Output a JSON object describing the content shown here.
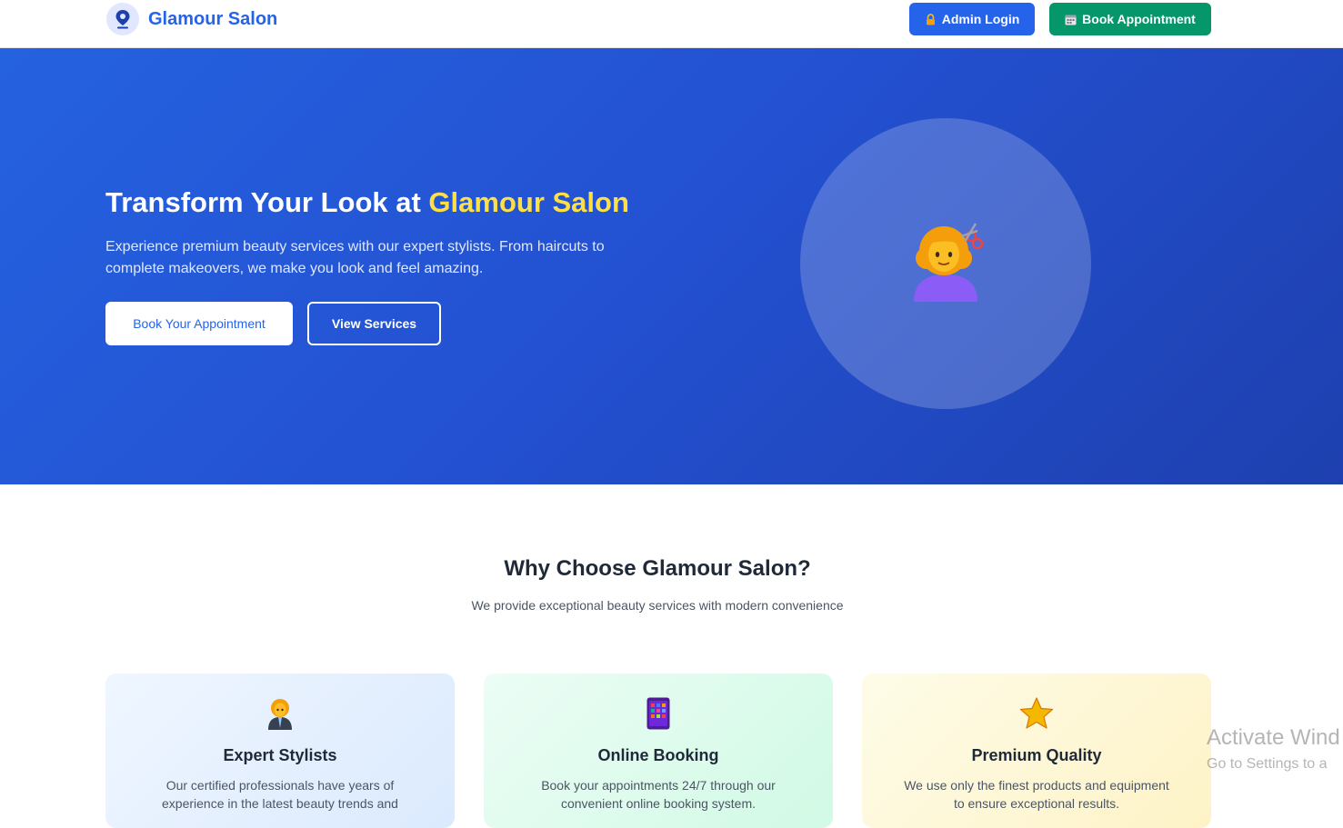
{
  "navbar": {
    "brand_name": "Glamour Salon",
    "brand_icon": "location-pin-icon",
    "admin_login_label": "Admin Login",
    "admin_login_icon": "lock-icon",
    "book_appointment_label": "Book Appointment",
    "book_appointment_icon": "calendar-icon"
  },
  "hero": {
    "title_prefix": "Transform Your Look at ",
    "title_accent": "Glamour Salon",
    "description": "Experience premium beauty services with our expert stylists. From haircuts to complete makeovers, we make you look and feel amazing.",
    "primary_button": "Book Your Appointment",
    "secondary_button": "View Services",
    "illustration_icon": "woman-getting-haircut-icon"
  },
  "why": {
    "title": "Why Choose Glamour Salon?",
    "subtitle": "We provide exceptional beauty services with modern convenience",
    "cards": [
      {
        "icon": "woman-office-worker-icon",
        "title": "Expert Stylists",
        "text": "Our certified professionals have years of experience in the latest beauty trends and"
      },
      {
        "icon": "mobile-phone-icon",
        "title": "Online Booking",
        "text": "Book your appointments 24/7 through our convenient online booking system."
      },
      {
        "icon": "star-icon",
        "title": "Premium Quality",
        "text": "We use only the finest products and equipment to ensure exceptional results."
      }
    ]
  },
  "watermark": {
    "title": "Activate Wind",
    "subtitle": "Go to Settings to a"
  },
  "colors": {
    "primary": "#2563eb",
    "success": "#059669",
    "accent_yellow": "#fde047"
  }
}
